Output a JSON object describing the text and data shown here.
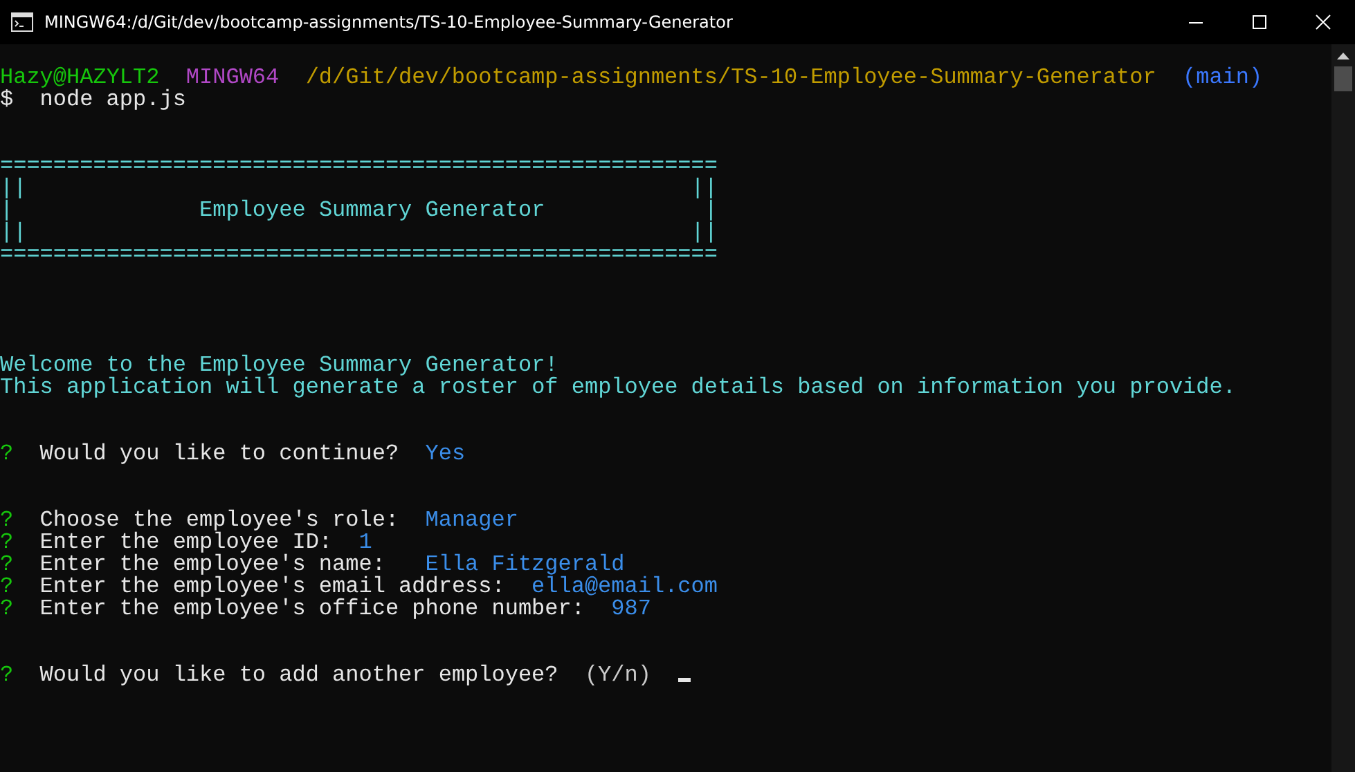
{
  "window": {
    "title": "MINGW64:/d/Git/dev/bootcamp-assignments/TS-10-Employee-Summary-Generator"
  },
  "lines": [
    {
      "kind": "prompt",
      "user": "Hazy@HAZYLT2",
      "host": "MINGW64",
      "path": "/d/Git/dev/bootcamp-assignments/TS-10-Employee-Summary-Generator",
      "branch": "(main)"
    },
    {
      "kind": "command",
      "symbol": "$",
      "text": "node app.js"
    },
    {
      "kind": "blank"
    },
    {
      "kind": "blank"
    },
    {
      "kind": "banner",
      "text": "======================================================"
    },
    {
      "kind": "banner",
      "text": "||                                                  ||"
    },
    {
      "kind": "banner",
      "text": "|              Employee Summary Generator            |"
    },
    {
      "kind": "banner",
      "text": "||                                                  ||"
    },
    {
      "kind": "banner",
      "text": "======================================================"
    },
    {
      "kind": "blank"
    },
    {
      "kind": "blank"
    },
    {
      "kind": "blank"
    },
    {
      "kind": "blank"
    },
    {
      "kind": "info",
      "text": "Welcome to the Employee Summary Generator!"
    },
    {
      "kind": "info",
      "text": "This application will generate a roster of employee details based on information you provide."
    },
    {
      "kind": "blank"
    },
    {
      "kind": "blank"
    },
    {
      "kind": "question",
      "mark": "?",
      "text": "Would you like to continue?",
      "answer": "Yes"
    },
    {
      "kind": "blank"
    },
    {
      "kind": "blank"
    },
    {
      "kind": "question",
      "mark": "?",
      "text": "Choose the employee's role:",
      "answer": "Manager"
    },
    {
      "kind": "question",
      "mark": "?",
      "text": "Enter the employee ID:",
      "answer": "1"
    },
    {
      "kind": "question",
      "mark": "?",
      "text": "Enter the employee's name: ",
      "answer": "Ella Fitzgerald"
    },
    {
      "kind": "question",
      "mark": "?",
      "text": "Enter the employee's email address:",
      "answer": "ella@email.com"
    },
    {
      "kind": "question",
      "mark": "?",
      "text": "Enter the employee's office phone number:",
      "answer": "987"
    },
    {
      "kind": "blank"
    },
    {
      "kind": "blank"
    },
    {
      "kind": "pending",
      "mark": "?",
      "text": "Would you like to add another employee?",
      "hint": "(Y/n)"
    }
  ]
}
